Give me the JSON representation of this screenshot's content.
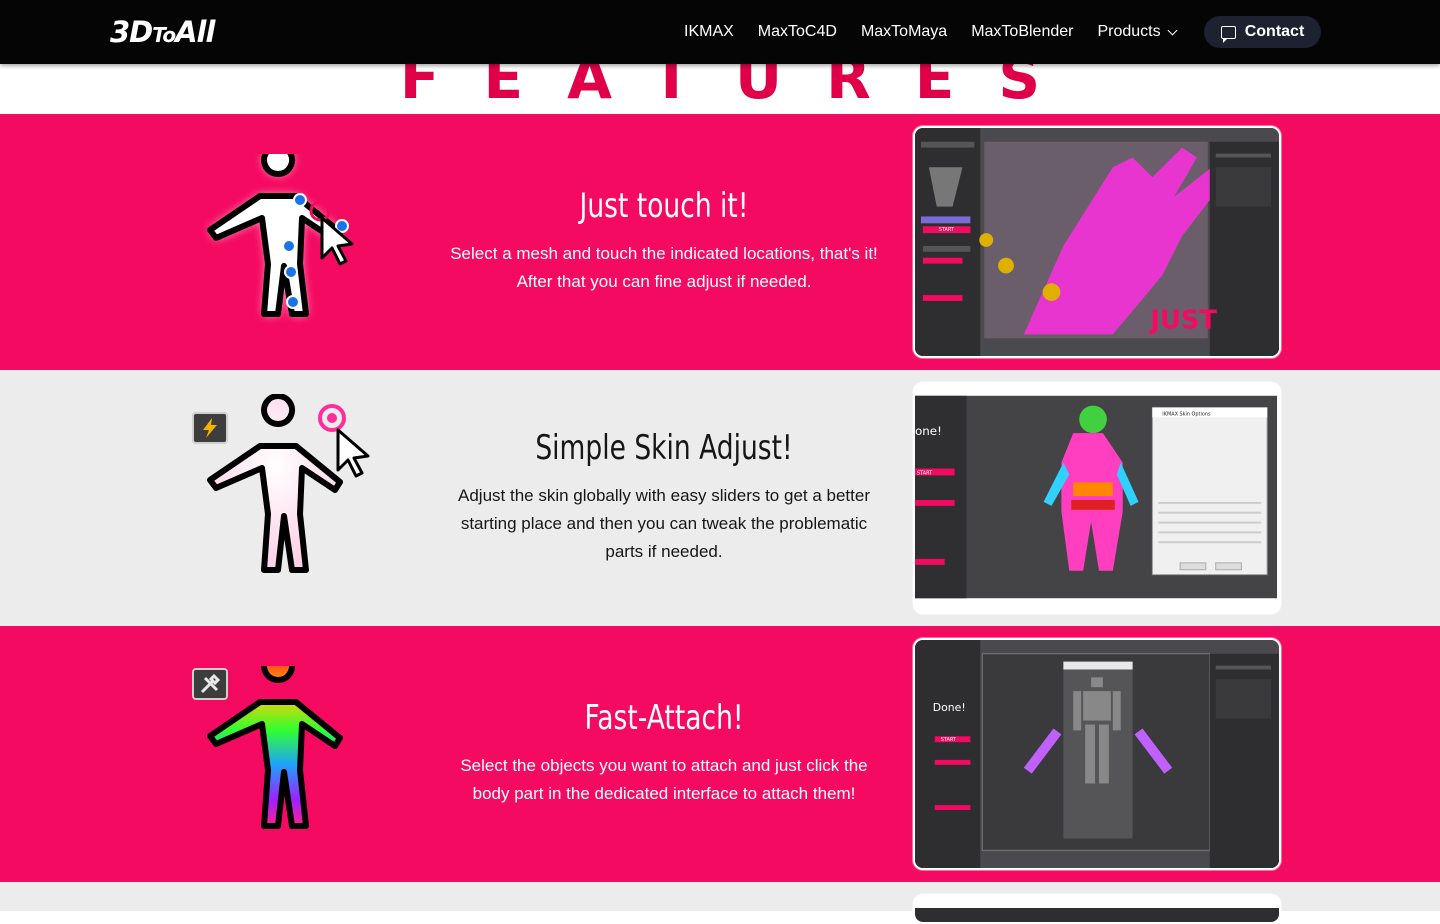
{
  "nav": {
    "logo_main": "3D",
    "logo_mid": "To",
    "logo_end": "All",
    "links": [
      "IKMAX",
      "MaxToC4D",
      "MaxToMaya",
      "MaxToBlender"
    ],
    "products_label": "Products",
    "contact_label": "Contact"
  },
  "features_heading": "FEATURES",
  "sections": [
    {
      "title": "Just touch it!",
      "desc_line1": "Select a mesh and touch the indicated locations, that's it!",
      "desc_line2": "After that you can fine adjust if needed.",
      "shot_label": "JUST",
      "shot_button": "START"
    },
    {
      "title": "Simple Skin Adjust!",
      "desc_line1": "Adjust the skin globally with easy sliders to get a better",
      "desc_line2": "starting place and then you can tweak the problematic",
      "desc_line3": "parts if needed.",
      "shot_label": "one!",
      "shot_button": "START",
      "shot_dialog_title": "IKMAX Skin Options"
    },
    {
      "title": "Fast-Attach!",
      "desc_line1": "Select the objects you want to attach and just click the",
      "desc_line2": "body part in the dedicated interface to attach them!",
      "shot_label": "Done!",
      "shot_button": "START"
    }
  ],
  "colors": {
    "brand_pink": "#f50a61",
    "heading_pink": "#e0004a",
    "nav_bg": "#050505",
    "grey_bg": "#ececec"
  }
}
